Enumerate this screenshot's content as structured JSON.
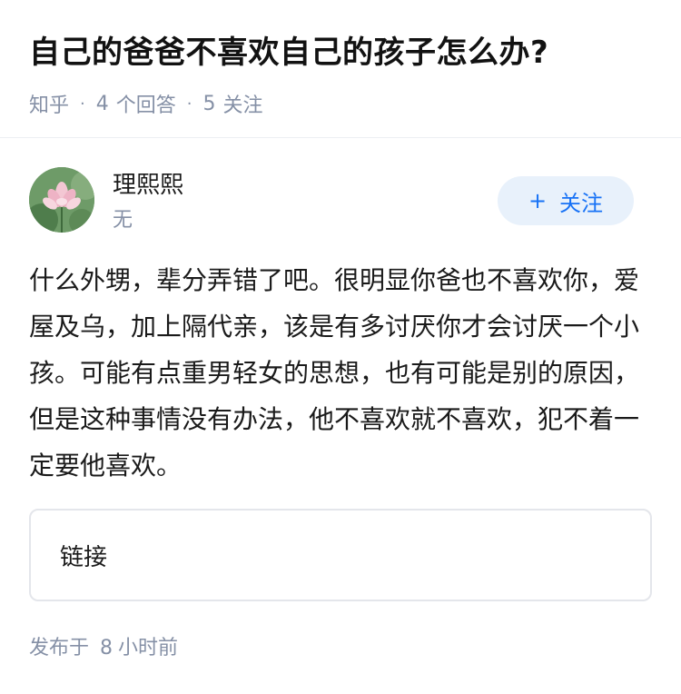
{
  "question": {
    "title": "自己的爸爸不喜欢自己的孩子怎么办?",
    "source": "知乎",
    "answer_count": "4",
    "answer_label": "个回答",
    "follow_count": "5",
    "follow_label": "关注"
  },
  "author": {
    "name": "理熙熙",
    "bio": "无",
    "avatar_icon": "lotus-avatar",
    "follow_plus": "+",
    "follow_label": "关注"
  },
  "answer": {
    "paragraph": "什么外甥，辈分弄错了吧。很明显你爸也不喜欢你，爱屋及乌，加上隔代亲，该是有多讨厌你才会讨厌一个小孩。可能有点重男轻女的思想，也有可能是别的原因，但是这种事情没有办法，他不喜欢就不喜欢，犯不着一定要他喜欢。"
  },
  "link_card": {
    "label": "链接"
  },
  "footer": {
    "published_label": "发布于",
    "published_value": "8",
    "published_unit": "小时前"
  },
  "colors": {
    "meta_gray": "#8590a6",
    "accent_blue": "#1772f6",
    "follow_bg": "#e8f1fb"
  }
}
